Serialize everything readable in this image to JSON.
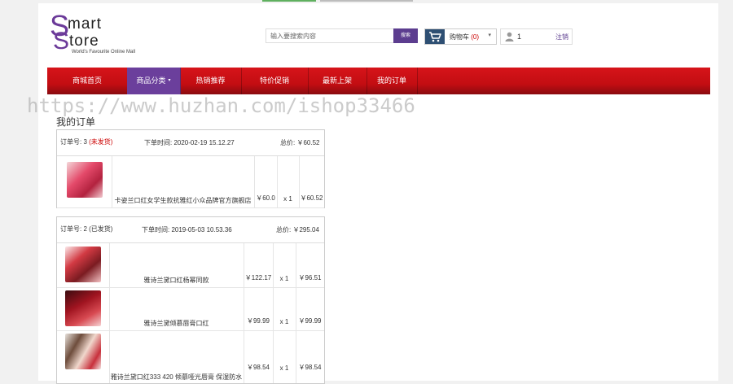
{
  "brand": {
    "s1": "S",
    "w1": "mart",
    "s2": "S",
    "w2": "tore",
    "tagline": "World's Favourite Online Mall"
  },
  "search": {
    "placeholder": "输入要搜索内容",
    "button": "搜索"
  },
  "cart": {
    "label": "购物车",
    "count": "(0)"
  },
  "user": {
    "count": "1",
    "logout": "注销"
  },
  "nav": {
    "items": [
      {
        "label": "商城首页"
      },
      {
        "label": "商品分类"
      },
      {
        "label": "热销推荐"
      },
      {
        "label": "特价促销"
      },
      {
        "label": "最新上架"
      },
      {
        "label": "我的订单"
      }
    ],
    "active": "商品分类"
  },
  "watermark": "https://www.huzhan.com/ishop33466",
  "page_title": "我的订单",
  "orders": [
    {
      "order_no": "订单号: 3",
      "status": "(未发货)",
      "order_time": "下单时间: 2020-02-19 15.12.27",
      "total_label": "总价:",
      "total": "￥60.52",
      "products": [
        {
          "name": "卡姿兰口红女学生款抗雅红小众品牌官方旗舰店",
          "price": "￥60.0",
          "qty": "x 1",
          "subtotal": "￥60.52"
        }
      ]
    },
    {
      "order_no": "订单号: 2",
      "status": "(已发货)",
      "order_time": "下单时间: 2019-05-03 10.53.36",
      "total_label": "总价:",
      "total": "￥295.04",
      "products": [
        {
          "name": "雅诗兰黛口红杨幂同款",
          "price": "￥122.17",
          "qty": "x 1",
          "subtotal": "￥96.51"
        },
        {
          "name": "雅诗兰黛倾慕唇膏口红",
          "price": "￥99.99",
          "qty": "x 1",
          "subtotal": "￥99.99"
        },
        {
          "name": "雅诗兰黛口红333 420 倾慕哑光唇膏 保湿防水",
          "price": "￥98.54",
          "qty": "x 1",
          "subtotal": "￥98.54"
        }
      ]
    }
  ],
  "colors": {
    "brand_purple": "#6b3a99",
    "nav_red": "#cc1016",
    "status_red": "#cc0000",
    "cart_blue": "#2e4f73"
  }
}
